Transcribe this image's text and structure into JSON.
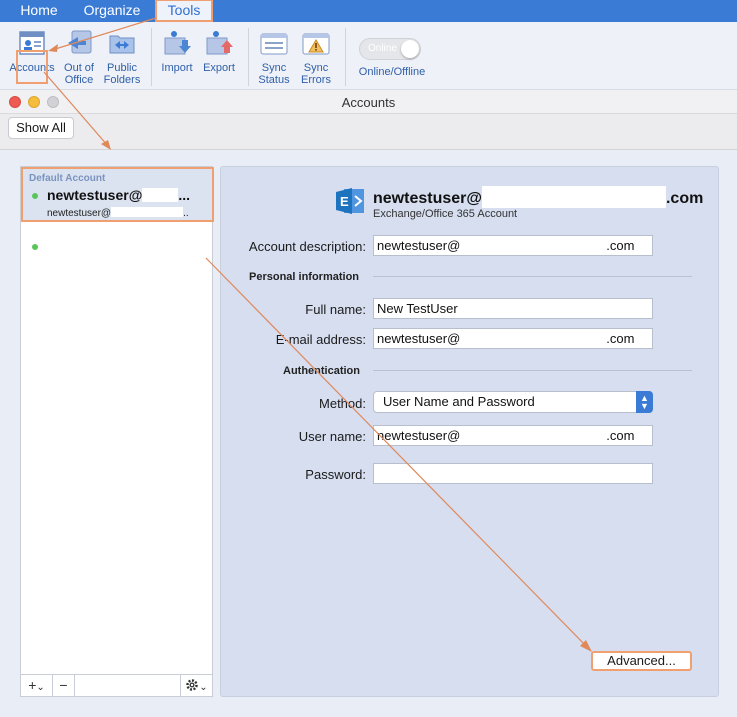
{
  "ribbon": {
    "tabs": [
      "Home",
      "Organize",
      "Tools"
    ],
    "tools": {
      "accounts": "Accounts",
      "out_of_office": [
        "Out of",
        "Office"
      ],
      "public_folders": [
        "Public",
        "Folders"
      ],
      "import": "Import",
      "export": "Export",
      "sync_status": [
        "Sync",
        "Status"
      ],
      "sync_errors": [
        "Sync",
        "Errors"
      ]
    },
    "toggle": {
      "text": "Online",
      "caption": "Online/Offline"
    }
  },
  "window": {
    "title": "Accounts",
    "show_all": "Show All"
  },
  "account_list": {
    "default_label": "Default Account",
    "selected": {
      "name_prefix": "newtestuser@",
      "name_suffix": "...",
      "email_prefix": "newtestuser@",
      "email_suffix": ".."
    }
  },
  "list_footer": {
    "add": "+",
    "add_chevron": "⌄",
    "remove": "−",
    "gear_chevron": "⌄"
  },
  "detail": {
    "header_prefix": "newtestuser@",
    "header_suffix": ".com",
    "account_type": "Exchange/Office 365 Account",
    "labels": {
      "account_description": "Account description:",
      "personal_information": "Personal information",
      "full_name": "Full name:",
      "email_address": "E-mail address:",
      "authentication": "Authentication",
      "method": "Method:",
      "user_name": "User name:",
      "password": "Password:"
    },
    "values": {
      "account_description_prefix": "newtestuser@",
      "account_description_suffix": ".com",
      "full_name": "New TestUser",
      "email_prefix": "newtestuser@",
      "email_suffix": ".com",
      "method": "User Name and Password",
      "user_name_prefix": "newtestuser@",
      "user_name_suffix": ".com",
      "password": ""
    },
    "advanced_button": "Advanced..."
  },
  "colors": {
    "ribbon_blue": "#3a7bd5",
    "highlight_orange": "#f0a070",
    "status_green": "#5bc55b",
    "exchange_blue": "#1e73be"
  }
}
